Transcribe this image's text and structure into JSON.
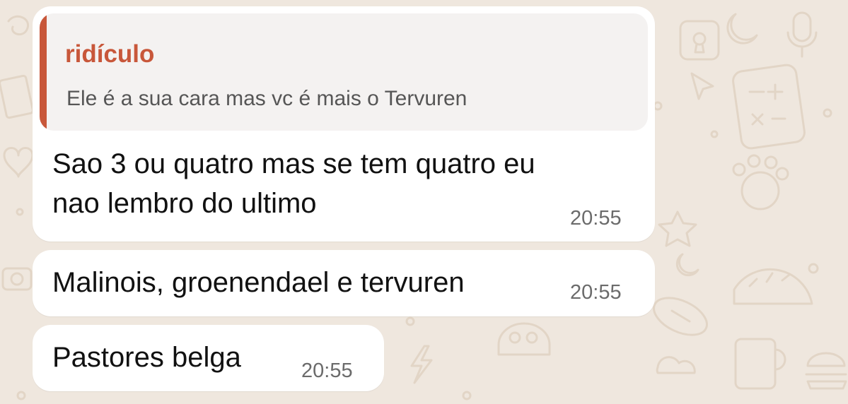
{
  "messages": [
    {
      "quote": {
        "author": "ridículo",
        "text": "Ele é a sua cara mas vc é mais o Tervuren"
      },
      "line1": "Sao 3 ou quatro mas se tem quatro eu",
      "line2": "nao lembro do ultimo",
      "time": "20:55"
    },
    {
      "text": "Malinois, groenendael e tervuren",
      "time": "20:55"
    },
    {
      "text": "Pastores belga",
      "time": "20:55"
    }
  ],
  "colors": {
    "wallpaper": "#efe7de",
    "doodle": "#e2d5c6",
    "bubble": "#ffffff",
    "quote_background": "#f4f2f1",
    "quote_accent": "#c8573a",
    "timestamp": "#6b6b6b"
  }
}
